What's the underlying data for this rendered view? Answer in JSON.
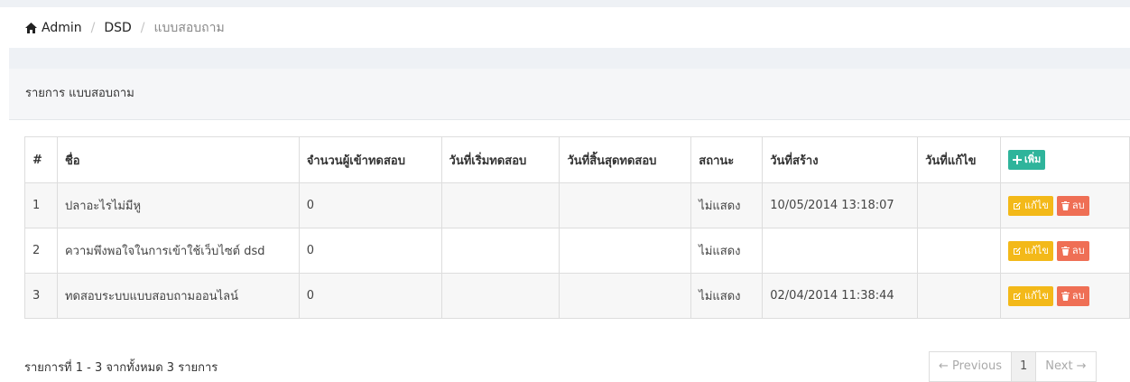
{
  "breadcrumb": {
    "icon": "home-icon",
    "items": [
      "Admin",
      "DSD"
    ],
    "active": "แบบสอบถาม",
    "separator": "/"
  },
  "panel": {
    "title": "รายการ แบบสอบถาม"
  },
  "table": {
    "headers": {
      "num": "#",
      "name": "ชื่อ",
      "participants": "จำนวนผู้เข้าทดสอบ",
      "start": "วันที่เริ่มทดสอบ",
      "end": "วันที่สิ้นสุดทดสอบ",
      "status": "สถานะ",
      "created": "วันที่สร้าง",
      "modified": "วันที่แก้ไข"
    },
    "add_label": "เพิ่ม",
    "edit_label": "แก้ไข",
    "delete_label": "ลบ",
    "rows": [
      {
        "num": "1",
        "name": "ปลาอะไรไม่มีหู",
        "participants": "0",
        "start": "",
        "end": "",
        "status": "ไม่แสดง",
        "created": "10/05/2014 13:18:07",
        "modified": ""
      },
      {
        "num": "2",
        "name": "ความพึงพอใจในการเข้าใช้เว็บไซต์ dsd",
        "participants": "0",
        "start": "",
        "end": "",
        "status": "ไม่แสดง",
        "created": "",
        "modified": ""
      },
      {
        "num": "3",
        "name": "ทดสอบระบบแบบสอบถามออนไลน์",
        "participants": "0",
        "start": "",
        "end": "",
        "status": "ไม่แสดง",
        "created": "02/04/2014 11:38:44",
        "modified": ""
      }
    ]
  },
  "footer": {
    "info": "รายการที่ 1 - 3 จากทั้งหมด 3 รายการ",
    "prev": "← Previous",
    "page": "1",
    "next": "Next →"
  },
  "colors": {
    "add": "#2fb49b",
    "edit": "#f3b919",
    "delete": "#ef6f55",
    "background": "#eef1f5"
  }
}
